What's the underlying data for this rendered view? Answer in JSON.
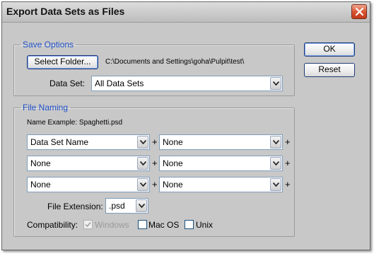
{
  "window": {
    "title": "Export Data Sets as Files"
  },
  "buttons": {
    "ok": "OK",
    "reset": "Reset",
    "select_folder": "Select Folder..."
  },
  "save_options": {
    "legend": "Save Options",
    "folder_path": "C:\\Documents and Settings\\goha\\Pulpit\\test\\",
    "data_set_label": "Data Set:",
    "data_set_value": "All Data Sets"
  },
  "file_naming": {
    "legend": "File Naming",
    "name_example": "Name Example: Spaghetti.psd",
    "rows": [
      {
        "left": "Data Set Name",
        "right": "None"
      },
      {
        "left": "None",
        "right": "None"
      },
      {
        "left": "None",
        "right": "None"
      }
    ],
    "plus": "+",
    "extension_label": "File Extension:",
    "extension_value": ".psd",
    "compatibility_label": "Compatibility:",
    "compat": [
      {
        "label": "Windows",
        "checked": true,
        "enabled": false
      },
      {
        "label": "Mac OS",
        "checked": false,
        "enabled": true
      },
      {
        "label": "Unix",
        "checked": false,
        "enabled": true
      }
    ]
  },
  "icons": {
    "close": "close-icon",
    "dropdown": "chevron-down-icon",
    "check": "checkmark-icon"
  }
}
